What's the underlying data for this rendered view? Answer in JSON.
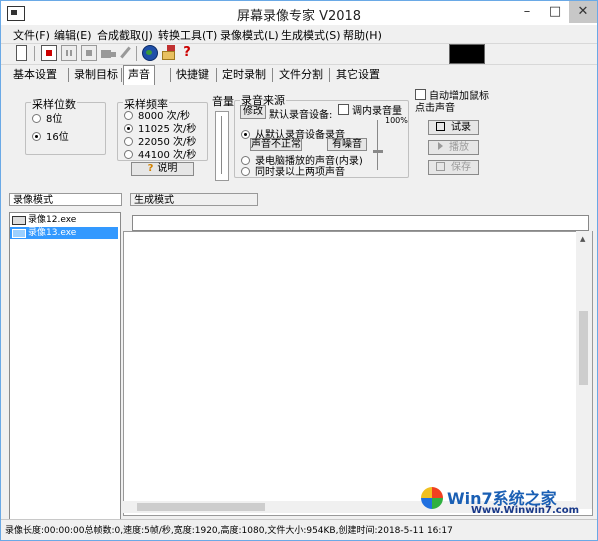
{
  "window": {
    "title": "屏幕录像专家 V2018"
  },
  "menu": [
    "文件(F)",
    "编辑(E)",
    "合成截取(J)",
    "转换工具(T)",
    "录像模式(L)",
    "生成模式(S)",
    "帮助(H)"
  ],
  "tabs": [
    {
      "label": "基本设置",
      "active": false
    },
    {
      "label": "录制目标",
      "active": false
    },
    {
      "label": "声音",
      "active": true
    },
    {
      "label": "快捷键",
      "active": false
    },
    {
      "label": "定时录制",
      "active": false
    },
    {
      "label": "文件分割",
      "active": false
    },
    {
      "label": "其它设置",
      "active": false
    }
  ],
  "sample_bits": {
    "title": "采样位数",
    "options": [
      "8位",
      "16位"
    ],
    "selected": 1
  },
  "sample_rate": {
    "title": "采样频率",
    "options": [
      "8000 次/秒",
      "11025 次/秒",
      "22050 次/秒",
      "44100 次/秒"
    ],
    "selected": 1,
    "help_label": "说明"
  },
  "volume": {
    "title": "音量"
  },
  "source": {
    "title": "录音来源",
    "modify_label": "修改",
    "default_device_label": "默认录音设备:",
    "adjust_label": "调内录音量",
    "percent_label": "100%",
    "options": [
      "从默认录音设备录音",
      "录电脑播放的声音(内录)",
      "同时录以上两项声音"
    ],
    "selected": 0,
    "abnormal_label": "声音不正常",
    "noise_label": "有噪音"
  },
  "auto_click": {
    "label": "自动增加鼠标点击声音"
  },
  "actions": {
    "test": "试录",
    "play": "播放",
    "save": "保存"
  },
  "lower_tabs": [
    "录像模式",
    "生成模式"
  ],
  "files": [
    {
      "name": "录像12.exe",
      "selected": false
    },
    {
      "name": "录像13.exe",
      "selected": true
    }
  ],
  "status": "录像长度:00:00:00总帧数:0,速度:5帧/秒,宽度:1920,高度:1080,文件大小:954KB,创建时间:2018-5-11 16:17",
  "watermark": {
    "brand": "Win7系统之家",
    "url": "Www.Winwin7.com"
  },
  "colors": {
    "accent": "#3399ff",
    "title_border": "#6aa9e6",
    "dark_box": "#000000"
  }
}
